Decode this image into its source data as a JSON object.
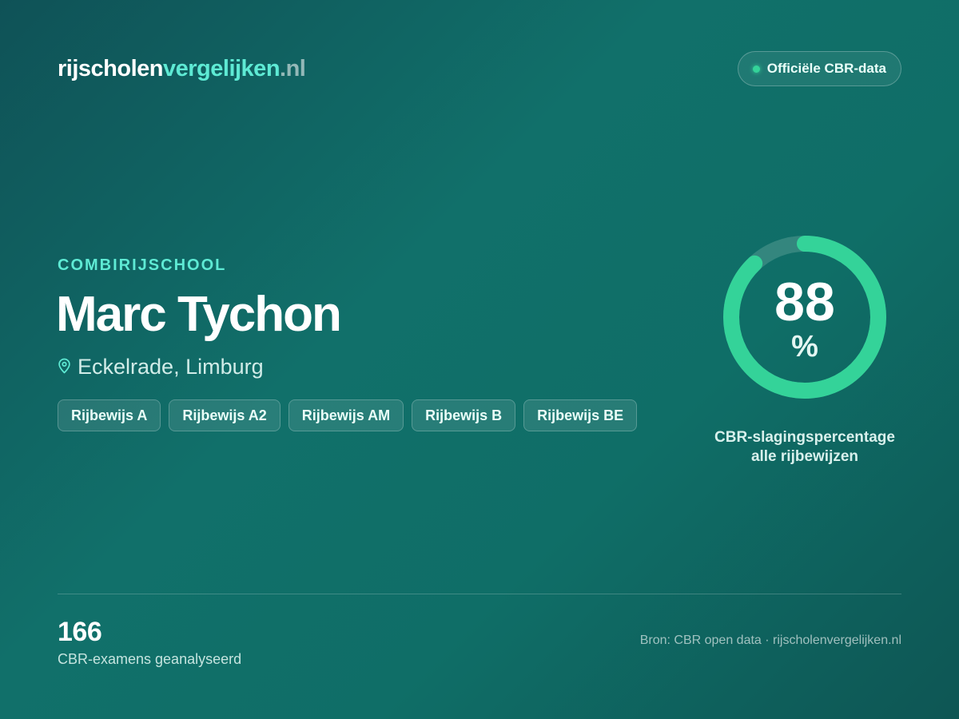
{
  "brand": {
    "part1": "rijscholen",
    "part2": "vergelijken",
    "part3": ".nl"
  },
  "badge": {
    "label": "Officiële CBR-data"
  },
  "school": {
    "category": "COMBIRIJSCHOOL",
    "name": "Marc Tychon",
    "location": "Eckelrade, Limburg",
    "licenses": [
      "Rijbewijs A",
      "Rijbewijs A2",
      "Rijbewijs AM",
      "Rijbewijs B",
      "Rijbewijs BE"
    ]
  },
  "pass_rate": {
    "value": 88,
    "value_text": "88",
    "unit": "%",
    "caption_line1": "CBR-slagingspercentage",
    "caption_line2": "alle rijbewijzen"
  },
  "stats": {
    "exams": "166",
    "exams_label": "CBR-examens geanalyseerd"
  },
  "footer": {
    "source": "Bron: CBR open data · rijscholenvergelijken.nl"
  },
  "colors": {
    "accent": "#5eead4",
    "ring": "#34d399",
    "ring_track": "#3d8c84"
  },
  "icons": {
    "location": "map-pin-icon",
    "badge_dot": "status-dot-icon"
  }
}
